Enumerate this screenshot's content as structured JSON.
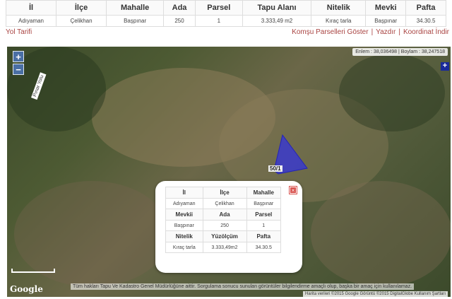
{
  "parcel_table": {
    "headers": [
      "İl",
      "İlçe",
      "Mahalle",
      "Ada",
      "Parsel",
      "Tapu Alanı",
      "Nitelik",
      "Mevki",
      "Pafta"
    ],
    "row": [
      "Adıyaman",
      "Çelikhan",
      "Başpınar",
      "250",
      "1",
      "3.333,49 m2",
      "Kıraç tarla",
      "Başpınar",
      "34.30.5"
    ]
  },
  "links": {
    "directions": "Yol Tarifi",
    "neighbor_parcels": "Komşu Parselleri Göster",
    "print": "Yazdır",
    "download_coords": "Koordinat İndir",
    "separator": "|"
  },
  "map": {
    "zoom_in": "+",
    "zoom_out": "−",
    "coords": "Enlem : 38,036498 | Boylam : 38,247518",
    "layers_symbol": "+",
    "road_label": "Pınar Yolu",
    "parcel_label": "50/1",
    "google_logo": "Google",
    "disclaimer": "Tüm hakları Tapu Ve Kadastro Genel Müdürlüğüne aittir. Sorgulama sonucu sunulan görüntüler bilgilendirme amaçlı olup, başka bir amaç için kullanılamaz.",
    "attribution": "Harita verileri ©2015 Google Görüntü ©2015 DigitalGlobe    Kullanım Şartları",
    "parcel_color": "#3333dd"
  },
  "popup": {
    "close": "×",
    "h1": [
      "İl",
      "İlçe",
      "Mahalle"
    ],
    "r1": [
      "Adıyaman",
      "Çelikhan",
      "Başpınar"
    ],
    "h2": [
      "Mevkii",
      "Ada",
      "Parsel"
    ],
    "r2": [
      "Başpınar",
      "250",
      "1"
    ],
    "h3": [
      "Nitelik",
      "Yüzölçüm",
      "Pafta"
    ],
    "r3": [
      "Kıraç tarla",
      "3.333,49m2",
      "34.30.5"
    ]
  }
}
